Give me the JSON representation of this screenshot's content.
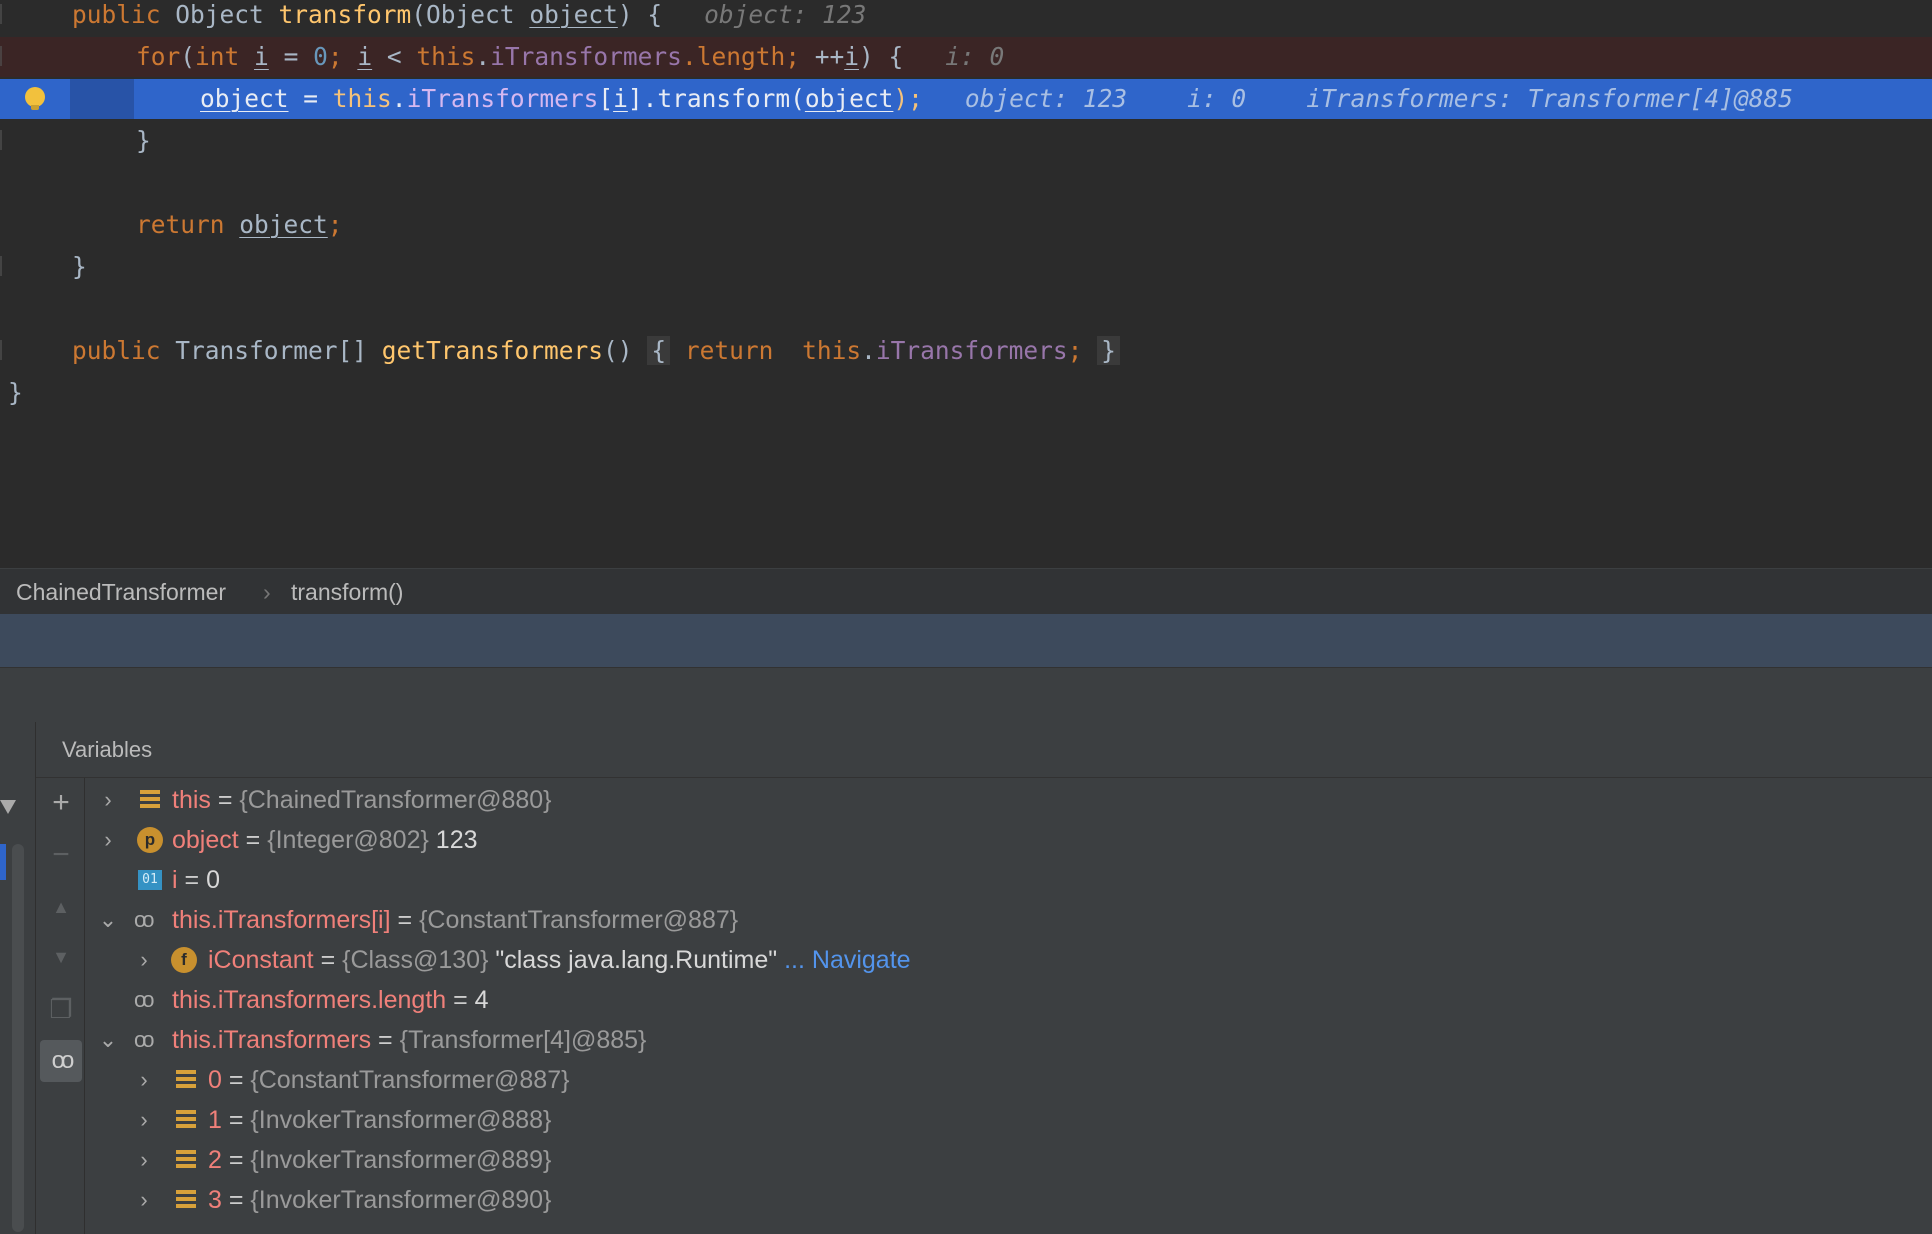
{
  "editor": {
    "line1": {
      "kw": "public ",
      "type": "Object ",
      "fn": "transform",
      "open": "(Object ",
      "param": "object",
      "close": ") {",
      "hint": "object: 123"
    },
    "line2": {
      "kw_for": "for",
      "p1": "(",
      "kw_int": "int ",
      "var_i": "i",
      "p2": " = ",
      "zero": "0",
      "p3": "; ",
      "var_i2": "i",
      "p4": " < ",
      "kw_this": "this",
      "p5": ".",
      "fld": "iTransformers",
      "p6": ".length; ",
      "p7": "++",
      "var_i3": "i",
      "p8": ") {",
      "hint": "i: 0"
    },
    "line3": {
      "var_obj": "object",
      "p1": " = ",
      "kw_this": "this",
      "p2": ".",
      "fld": "iTransformers",
      "p3": "[",
      "var_i": "i",
      "p4": "].transform(",
      "var_obj2": "object",
      "p5": ");",
      "hint1": "object: 123",
      "hint2": "i: 0",
      "hint3": "iTransformers: Transformer[4]@885"
    },
    "line4": "}",
    "line6": {
      "kw": "return ",
      "var": "object",
      "end": ";"
    },
    "line7": "}",
    "line9": {
      "kw": "public ",
      "type": "Transformer[] ",
      "fn": "getTransformers",
      "p1": "() ",
      "b1": "{",
      "kw_ret": " return ",
      "kw_this": "this",
      "p2": ".",
      "fld": "iTransformers",
      "p3": "; ",
      "b2": "}"
    },
    "line10": "}"
  },
  "breadcrumb": {
    "class": "ChainedTransformer",
    "sep": "›",
    "method": "transform()"
  },
  "variables": {
    "title": "Variables",
    "toolbar": {
      "add": "+",
      "remove": "−",
      "up": "▲",
      "down": "▼",
      "copy": "❐",
      "watches": "oo"
    },
    "rows": [
      {
        "chev": "›",
        "name": "this",
        "eq": " = ",
        "type": "{ChainedTransformer@880}",
        "value": ""
      },
      {
        "chev": "›",
        "icon": "p",
        "name": "object",
        "eq": " = ",
        "type": "{Integer@802}",
        "value": " 123"
      },
      {
        "icon": "01",
        "name": "i",
        "eq": " = ",
        "value": "0"
      },
      {
        "chev": "⌄",
        "name": "this.iTransformers[i]",
        "eq": " = ",
        "type": "{ConstantTransformer@887}"
      },
      {
        "chev": "›",
        "icon": "f",
        "name": "iConstant",
        "eq": " = ",
        "type": "{Class@130}",
        "value": " \"class java.lang.Runtime\"",
        "link": " ... Navigate"
      },
      {
        "name": "this.iTransformers.length",
        "eq": " = ",
        "value": "4"
      },
      {
        "chev": "⌄",
        "name": "this.iTransformers",
        "eq": " = ",
        "type": "{Transformer[4]@885}"
      },
      {
        "chev": "›",
        "name": "0",
        "eq": " = ",
        "type": "{ConstantTransformer@887}"
      },
      {
        "chev": "›",
        "name": "1",
        "eq": " = ",
        "type": "{InvokerTransformer@888}"
      },
      {
        "chev": "›",
        "name": "2",
        "eq": " = ",
        "type": "{InvokerTransformer@889}"
      },
      {
        "chev": "›",
        "name": "3",
        "eq": " = ",
        "type": "{InvokerTransformer@890}"
      }
    ]
  }
}
